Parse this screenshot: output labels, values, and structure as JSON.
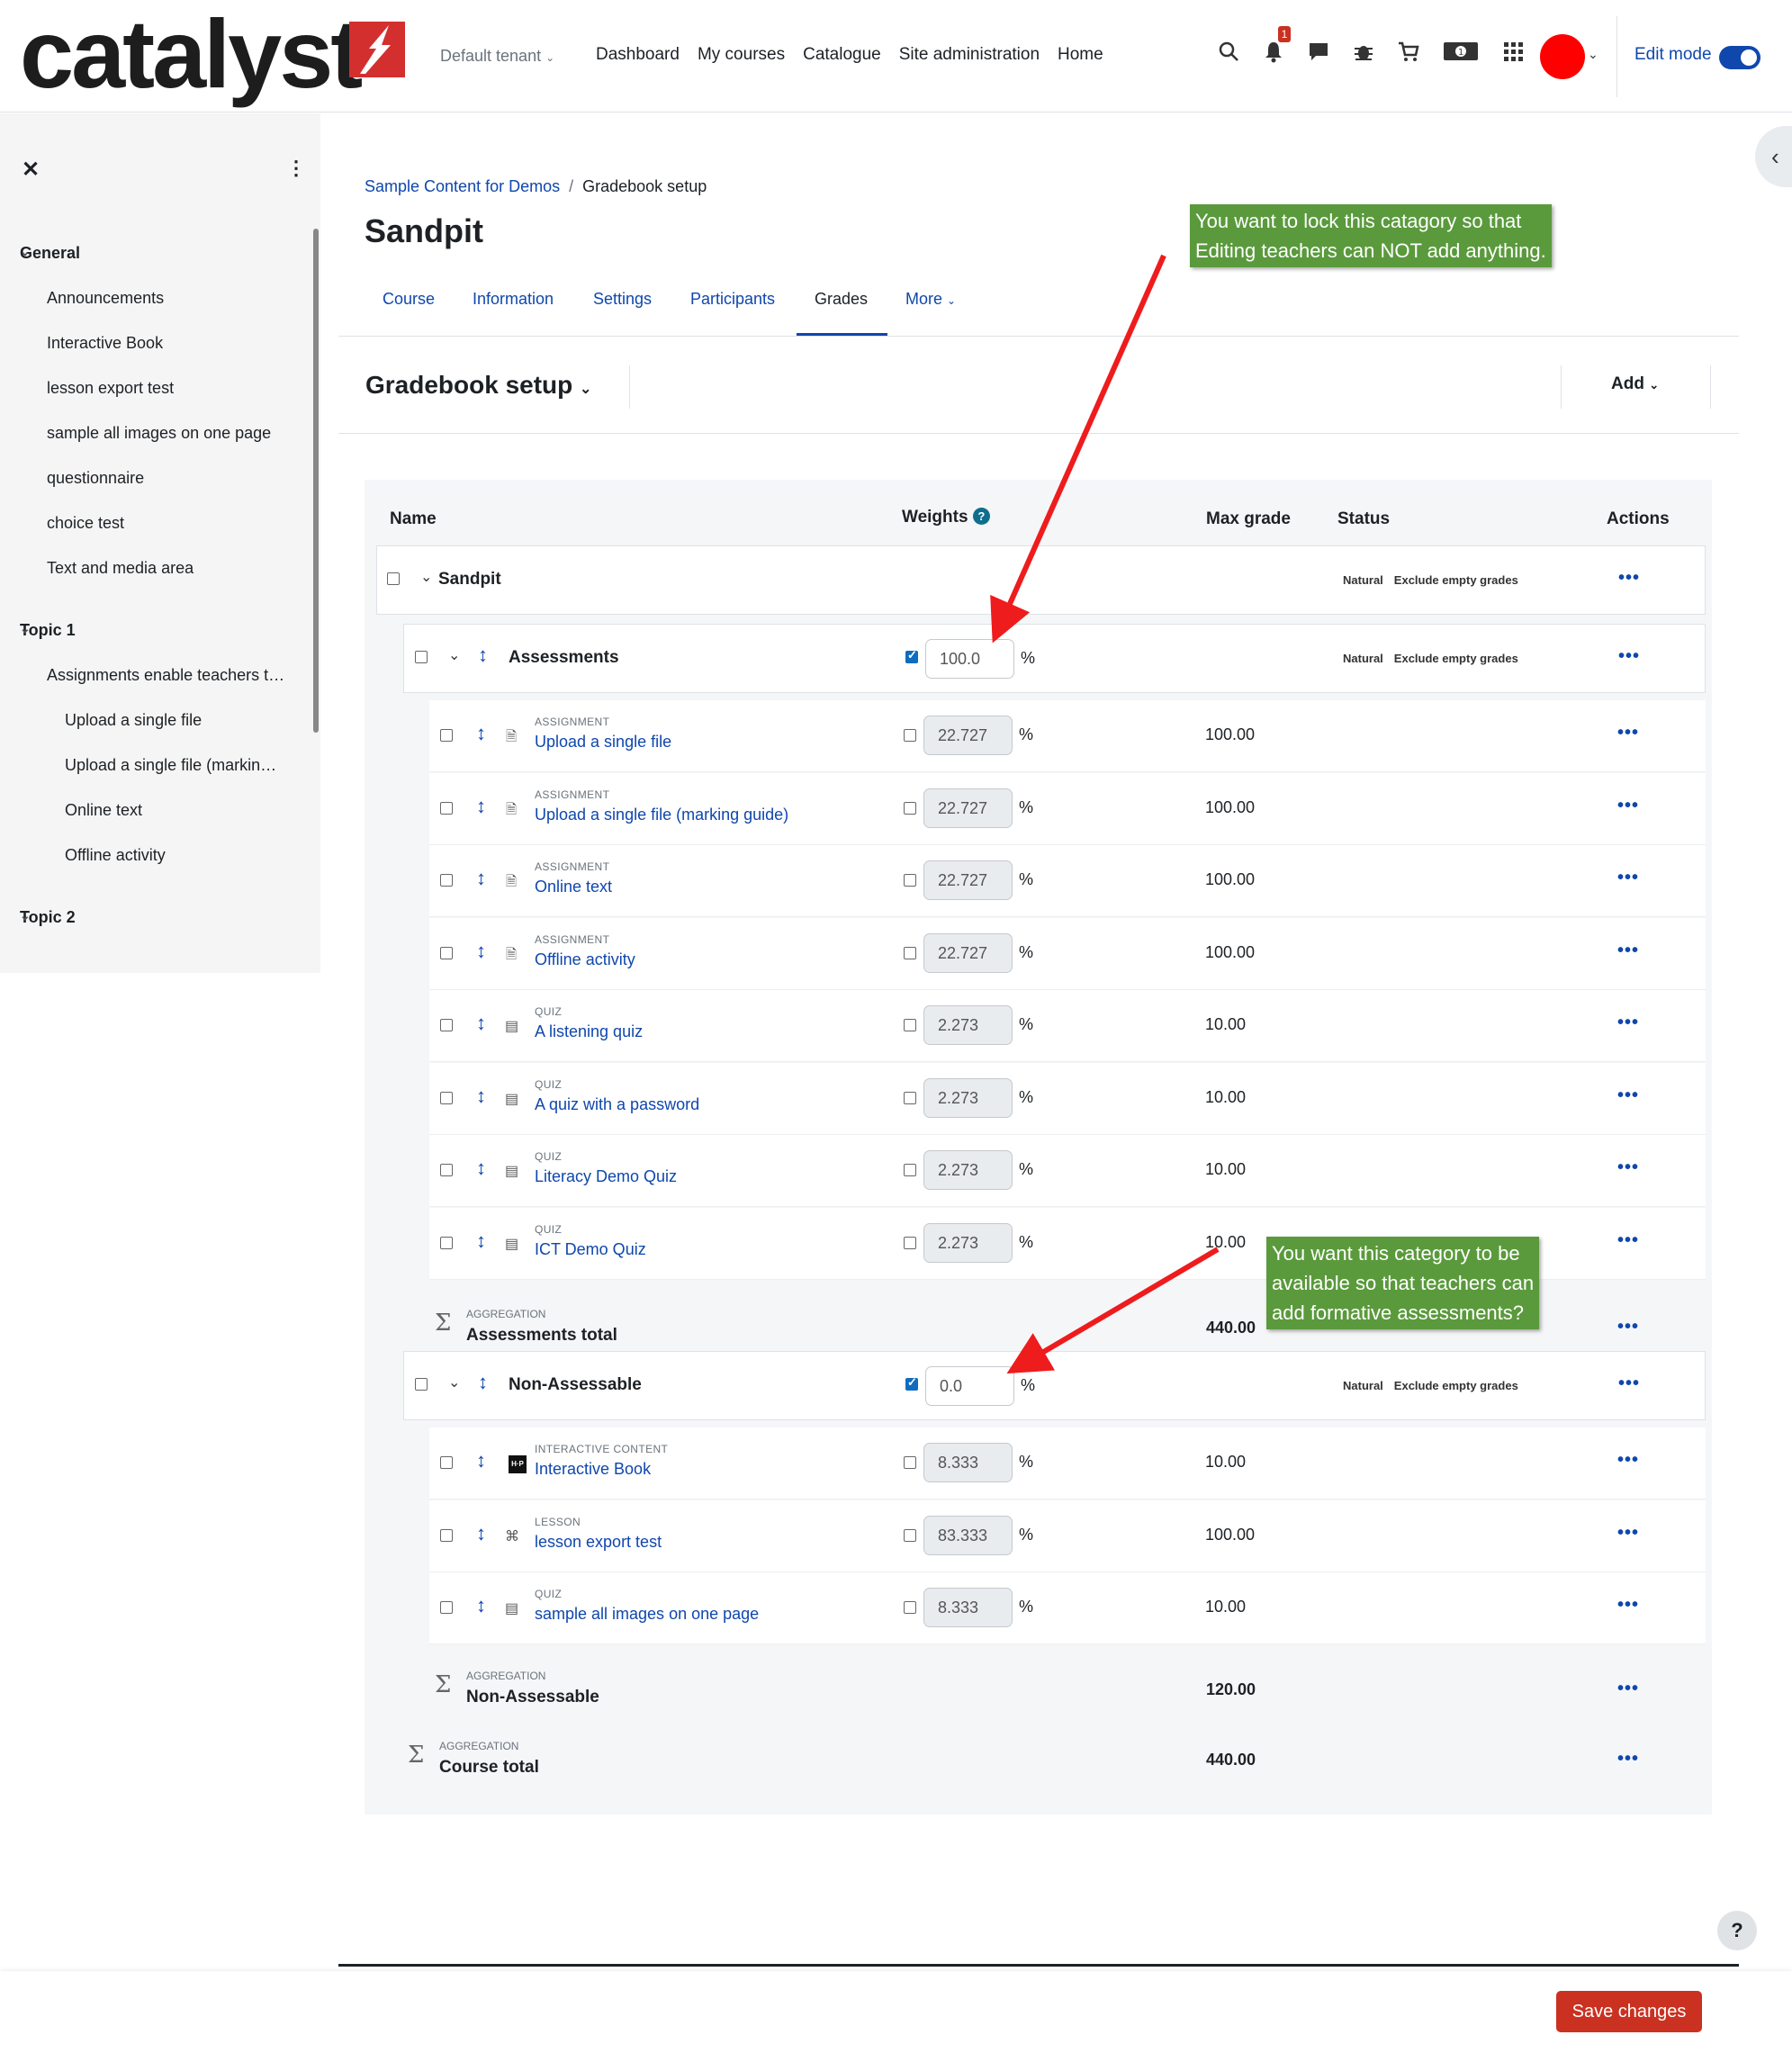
{
  "navbar": {
    "logo_text": "catalyst",
    "tenant": "Default tenant",
    "links": [
      "Dashboard",
      "My courses",
      "Catalogue",
      "Site administration",
      "Home"
    ],
    "notification_count": "1",
    "edit_mode_label": "Edit mode",
    "avatar_color": "#ff0000"
  },
  "drawer": {
    "sections": [
      {
        "title": "General",
        "items": [
          "Announcements",
          "Interactive Book",
          "lesson export test",
          "sample all images on one page",
          "questionnaire",
          "choice test",
          "Text and media area"
        ]
      },
      {
        "title": "Topic 1",
        "items": [
          "Assignments enable teachers t…",
          "Upload a single file",
          "Upload a single file (markin…",
          "Online text",
          "Offline activity"
        ]
      },
      {
        "title": "Topic 2",
        "items": []
      }
    ]
  },
  "breadcrumb": {
    "course": "Sample Content for Demos",
    "current": "Gradebook setup"
  },
  "page_title": "Sandpit",
  "tabs": [
    "Course",
    "Information",
    "Settings",
    "Participants",
    "Grades",
    "More"
  ],
  "active_tab": "Grades",
  "gradebook": {
    "title": "Gradebook setup",
    "add_label": "Add",
    "columns": {
      "name": "Name",
      "weights": "Weights",
      "max_grade": "Max grade",
      "status": "Status",
      "actions": "Actions"
    },
    "root": {
      "name": "Sandpit",
      "badges": [
        "Natural",
        "Exclude empty grades"
      ]
    },
    "categories": [
      {
        "name": "Assessments",
        "weight": "100.0",
        "weight_checked": true,
        "badges": [
          "Natural",
          "Exclude empty grades"
        ],
        "items": [
          {
            "type": "ASSIGNMENT",
            "name": "Upload a single file",
            "weight": "22.727",
            "max": "100.00"
          },
          {
            "type": "ASSIGNMENT",
            "name": "Upload a single file (marking guide)",
            "weight": "22.727",
            "max": "100.00"
          },
          {
            "type": "ASSIGNMENT",
            "name": "Online text",
            "weight": "22.727",
            "max": "100.00"
          },
          {
            "type": "ASSIGNMENT",
            "name": "Offline activity",
            "weight": "22.727",
            "max": "100.00"
          },
          {
            "type": "QUIZ",
            "name": "A listening quiz",
            "weight": "2.273",
            "max": "10.00"
          },
          {
            "type": "QUIZ",
            "name": "A quiz with a password",
            "weight": "2.273",
            "max": "10.00"
          },
          {
            "type": "QUIZ",
            "name": "Literacy Demo Quiz",
            "weight": "2.273",
            "max": "10.00"
          },
          {
            "type": "QUIZ",
            "name": "ICT Demo Quiz",
            "weight": "2.273",
            "max": "10.00"
          }
        ],
        "total": {
          "label": "AGGREGATION",
          "name": "Assessments total",
          "max": "440.00"
        }
      },
      {
        "name": "Non-Assessable",
        "weight": "0.0",
        "weight_checked": true,
        "badges": [
          "Natural",
          "Exclude empty grades"
        ],
        "items": [
          {
            "type": "INTERACTIVE CONTENT",
            "name": "Interactive Book",
            "weight": "8.333",
            "max": "10.00"
          },
          {
            "type": "LESSON",
            "name": "lesson export test",
            "weight": "83.333",
            "max": "100.00"
          },
          {
            "type": "QUIZ",
            "name": "sample all images on one page",
            "weight": "8.333",
            "max": "10.00"
          }
        ],
        "total": {
          "label": "AGGREGATION",
          "name": "Non-Assessable",
          "max": "120.00"
        }
      }
    ],
    "course_total": {
      "label": "AGGREGATION",
      "name": "Course total",
      "max": "440.00"
    },
    "percent_sign": "%",
    "actions_glyph": "•••"
  },
  "annotations": {
    "top": [
      "You want to lock this catagory so that",
      "Editing teachers can NOT add anything."
    ],
    "bottom": [
      "You want this category to be",
      "available so that teachers can",
      "add formative assessments?"
    ],
    "color": "#5a9a3c",
    "arrow_color": "#ee1c1c"
  },
  "footer": {
    "save_label": "Save changes",
    "help_label": "?"
  }
}
